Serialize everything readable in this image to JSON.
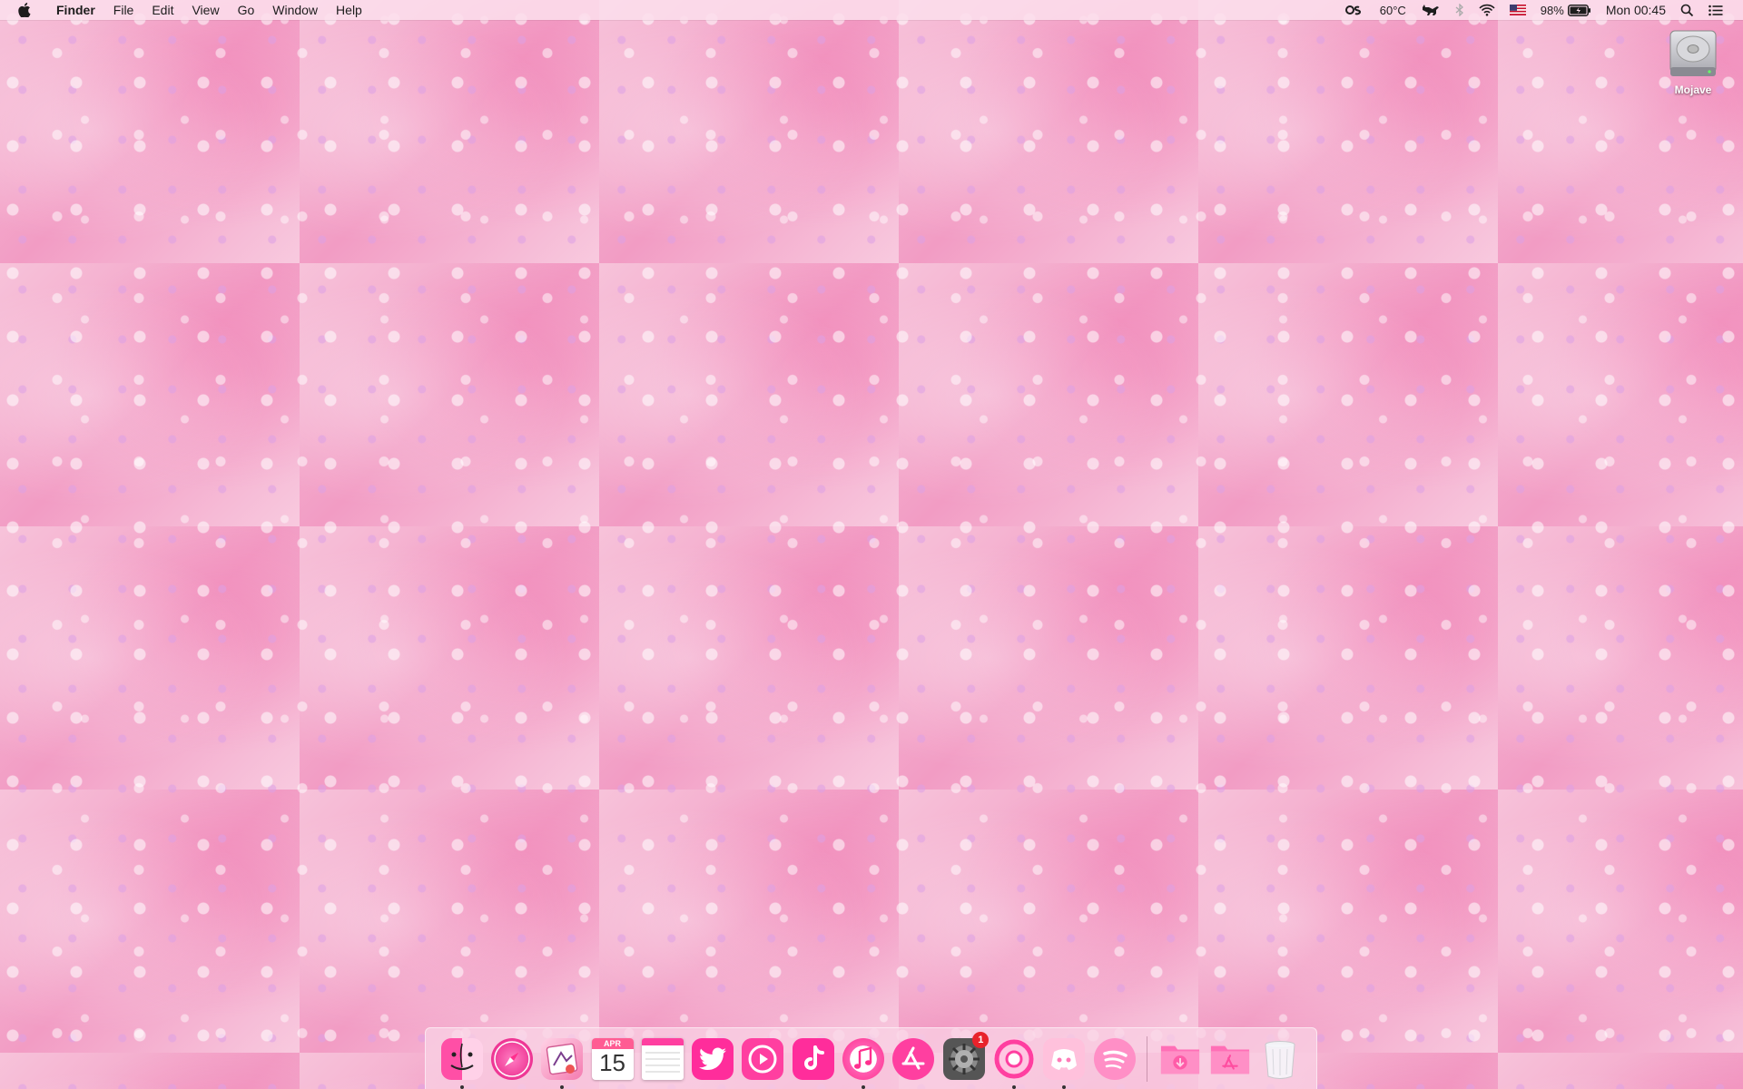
{
  "menubar": {
    "app_name": "Finder",
    "menus": [
      "File",
      "Edit",
      "View",
      "Go",
      "Window",
      "Help"
    ],
    "status": {
      "temperature": "60°C",
      "battery_percent": "98%",
      "clock": "Mon 00:45"
    },
    "icons": [
      "apple-icon",
      "activity-monitor-icon",
      "cat-icon",
      "bluetooth-icon",
      "wifi-icon",
      "us-flag-icon",
      "battery-icon",
      "spotlight-icon",
      "notification-center-icon"
    ]
  },
  "desktop": {
    "drive_label": "Mojave"
  },
  "dock": {
    "apps": [
      {
        "name": "Finder",
        "icon": "finder-icon",
        "running": true
      },
      {
        "name": "Safari",
        "icon": "safari-icon",
        "running": false
      },
      {
        "name": "Mail",
        "icon": "mail-icon",
        "running": true
      },
      {
        "name": "Calendar",
        "icon": "calendar-icon",
        "running": false
      },
      {
        "name": "Notes",
        "icon": "notes-icon",
        "running": false
      },
      {
        "name": "Twitter",
        "icon": "twitter-icon",
        "running": false
      },
      {
        "name": "Podcasts",
        "icon": "play-icon",
        "running": false
      },
      {
        "name": "TikTok",
        "icon": "tiktok-icon",
        "running": false
      },
      {
        "name": "Music",
        "icon": "music-icon",
        "running": true
      },
      {
        "name": "App Store",
        "icon": "appstore-icon",
        "running": false
      },
      {
        "name": "System Preferences",
        "icon": "gear-icon",
        "running": false
      },
      {
        "name": "Chrome",
        "icon": "chrome-icon",
        "running": true
      },
      {
        "name": "Discord",
        "icon": "discord-icon",
        "running": true
      },
      {
        "name": "Spotify",
        "icon": "spotify-icon",
        "running": false
      }
    ],
    "calendar": {
      "month": "APR",
      "day": "15"
    },
    "system_prefs_badge": "1",
    "folders": [
      "Downloads",
      "Applications"
    ],
    "trash": "Trash"
  },
  "colors": {
    "accent_pink": "#ff3fa0",
    "menubar_bg": "#fcdeec"
  }
}
